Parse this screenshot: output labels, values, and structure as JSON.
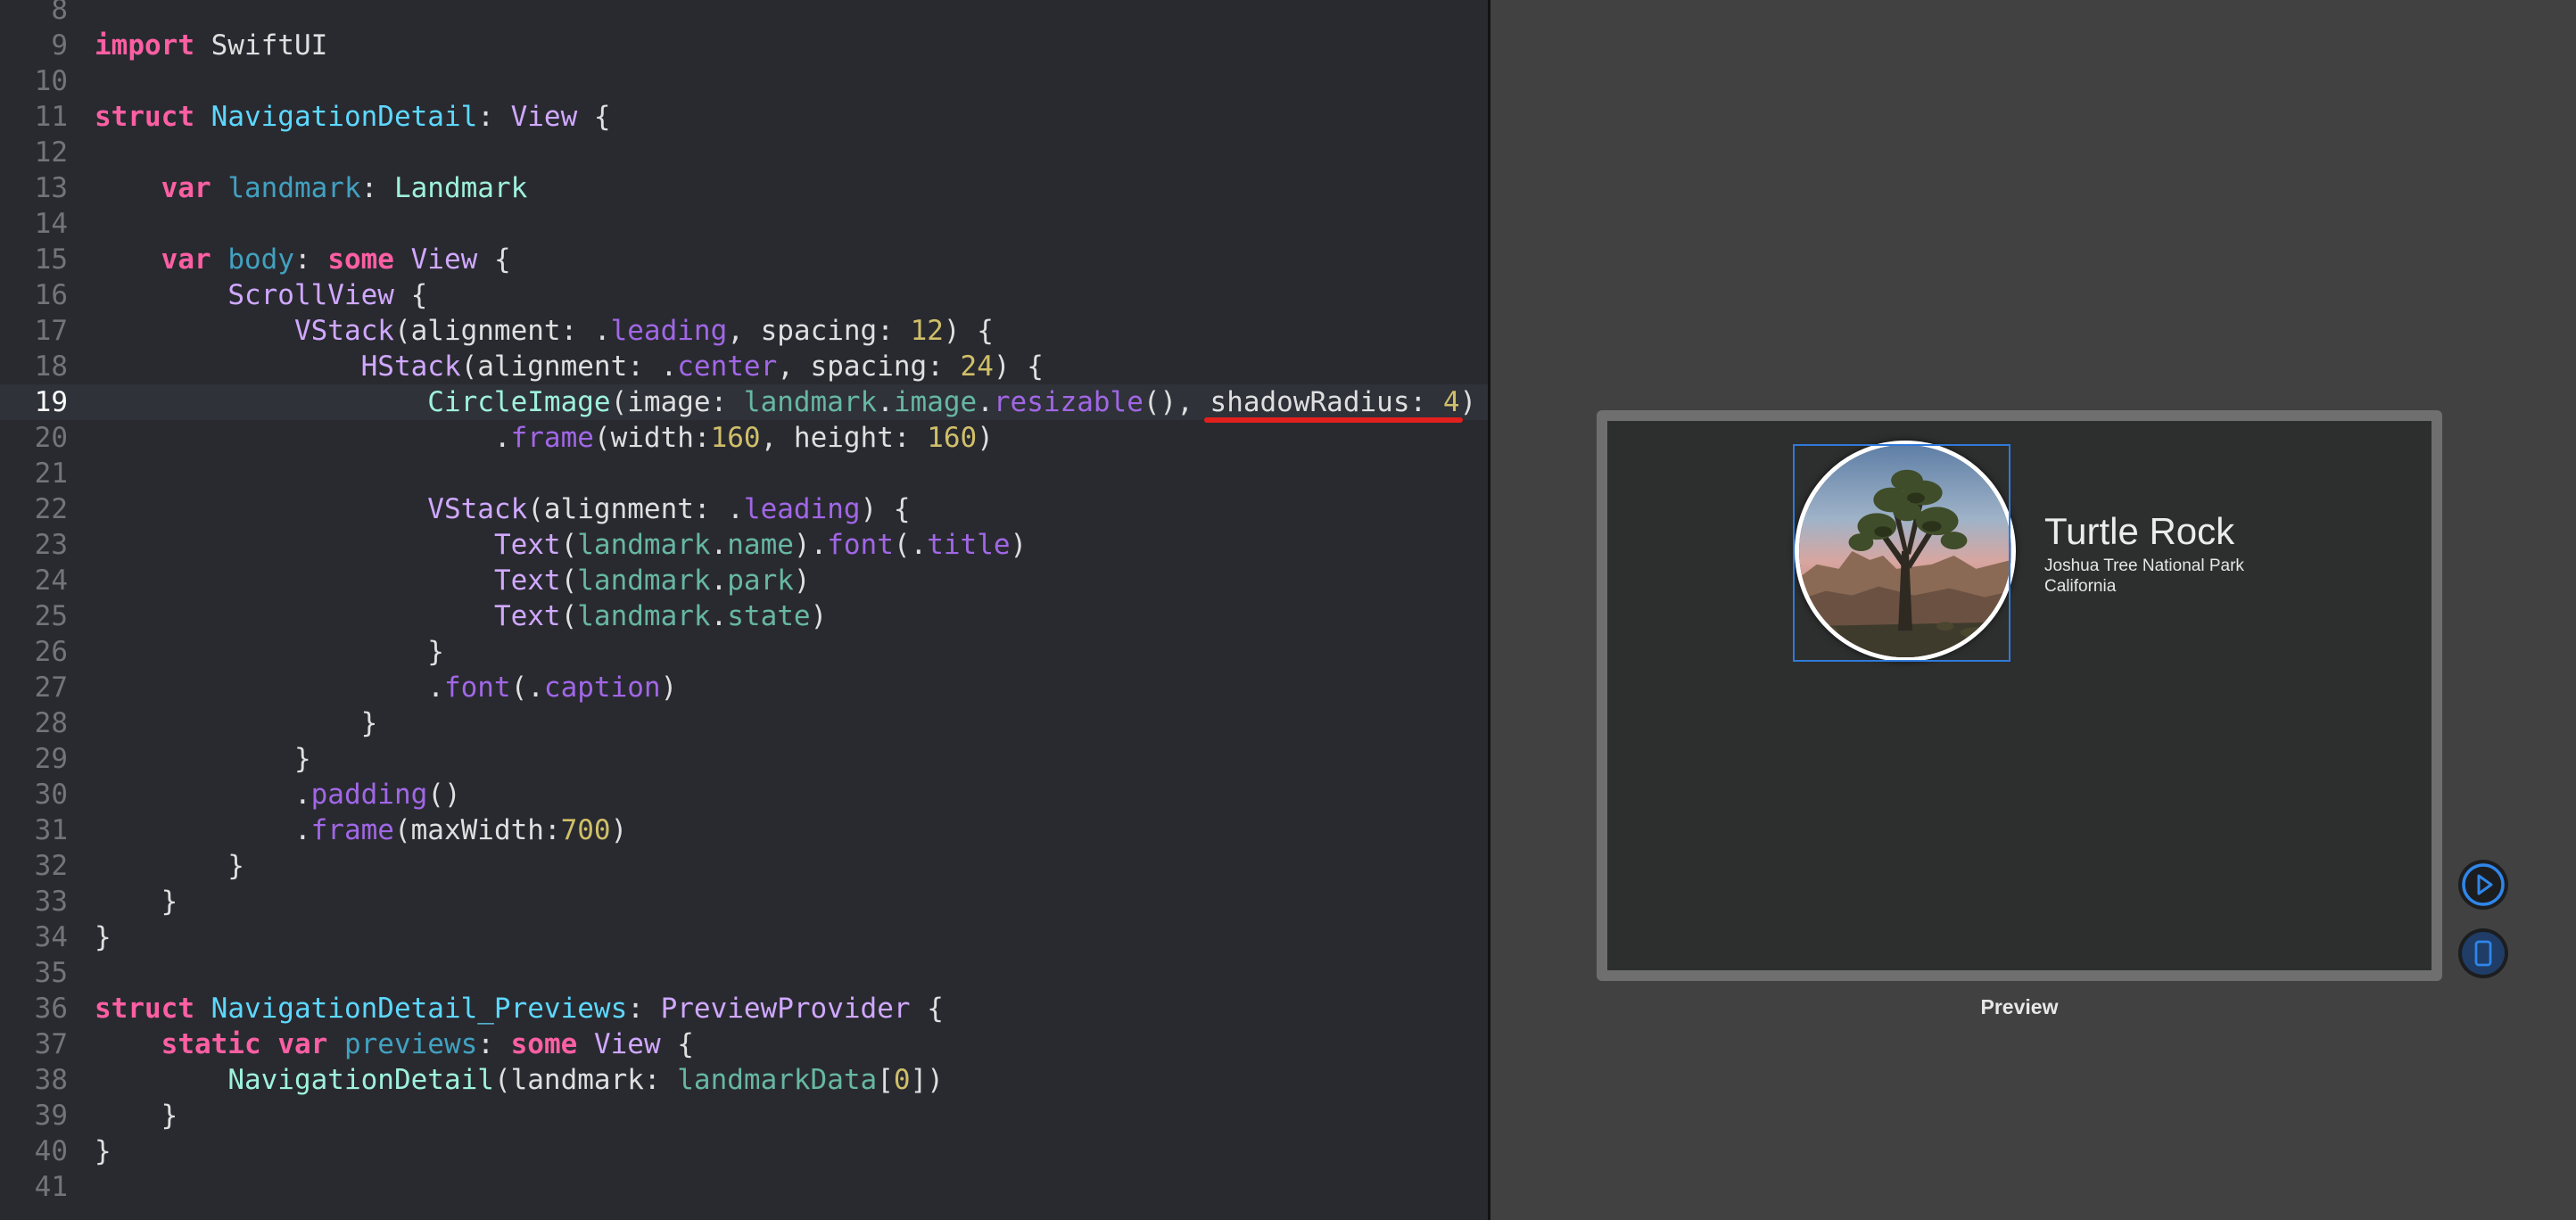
{
  "editor": {
    "current_line": "19",
    "lines": [
      {
        "n": "8",
        "t": []
      },
      {
        "n": "9",
        "t": [
          [
            "kw",
            "import"
          ],
          [
            "pl",
            " SwiftUI"
          ]
        ]
      },
      {
        "n": "10",
        "t": []
      },
      {
        "n": "11",
        "t": [
          [
            "kw",
            "struct"
          ],
          [
            "pl",
            " "
          ],
          [
            "typ",
            "NavigationDetail"
          ],
          [
            "pl",
            ": "
          ],
          [
            "ptype",
            "View"
          ],
          [
            "pl",
            " {"
          ]
        ]
      },
      {
        "n": "12",
        "t": []
      },
      {
        "n": "13",
        "t": [
          [
            "pl",
            "    "
          ],
          [
            "kw",
            "var"
          ],
          [
            "pl",
            " "
          ],
          [
            "decl",
            "landmark"
          ],
          [
            "pl",
            ": "
          ],
          [
            "tp",
            "Landmark"
          ]
        ]
      },
      {
        "n": "14",
        "t": []
      },
      {
        "n": "15",
        "t": [
          [
            "pl",
            "    "
          ],
          [
            "kw",
            "var"
          ],
          [
            "pl",
            " "
          ],
          [
            "decl",
            "body"
          ],
          [
            "pl",
            ": "
          ],
          [
            "kw",
            "some"
          ],
          [
            "pl",
            " "
          ],
          [
            "ptype",
            "View"
          ],
          [
            "pl",
            " {"
          ]
        ]
      },
      {
        "n": "16",
        "t": [
          [
            "pl",
            "        "
          ],
          [
            "ptype",
            "ScrollView"
          ],
          [
            "pl",
            " {"
          ]
        ]
      },
      {
        "n": "17",
        "t": [
          [
            "pl",
            "            "
          ],
          [
            "ptype",
            "VStack"
          ],
          [
            "pl",
            "(alignment: ."
          ],
          [
            "mem",
            "leading"
          ],
          [
            "pl",
            ", spacing: "
          ],
          [
            "num",
            "12"
          ],
          [
            "pl",
            ") {"
          ]
        ]
      },
      {
        "n": "18",
        "t": [
          [
            "pl",
            "                "
          ],
          [
            "ptype",
            "HStack"
          ],
          [
            "pl",
            "(alignment: ."
          ],
          [
            "mem",
            "center"
          ],
          [
            "pl",
            ", spacing: "
          ],
          [
            "num",
            "24"
          ],
          [
            "pl",
            ") {"
          ]
        ]
      },
      {
        "n": "19",
        "t": [
          [
            "pl",
            "                    "
          ],
          [
            "tp",
            "CircleImage"
          ],
          [
            "pl",
            "(image: "
          ],
          [
            "prj",
            "landmark"
          ],
          [
            "pl",
            "."
          ],
          [
            "prj",
            "image"
          ],
          [
            "pl",
            "."
          ],
          [
            "mem",
            "resizable"
          ],
          [
            "pl",
            "(), shadowRadius: "
          ],
          [
            "num",
            "4"
          ],
          [
            "pl",
            ")"
          ]
        ]
      },
      {
        "n": "20",
        "t": [
          [
            "pl",
            "                        ."
          ],
          [
            "mem",
            "frame"
          ],
          [
            "pl",
            "(width:"
          ],
          [
            "num",
            "160"
          ],
          [
            "pl",
            ", height: "
          ],
          [
            "num",
            "160"
          ],
          [
            "pl",
            ")"
          ]
        ]
      },
      {
        "n": "21",
        "t": []
      },
      {
        "n": "22",
        "t": [
          [
            "pl",
            "                    "
          ],
          [
            "ptype",
            "VStack"
          ],
          [
            "pl",
            "(alignment: ."
          ],
          [
            "mem",
            "leading"
          ],
          [
            "pl",
            ") {"
          ]
        ]
      },
      {
        "n": "23",
        "t": [
          [
            "pl",
            "                        "
          ],
          [
            "ptype",
            "Text"
          ],
          [
            "pl",
            "("
          ],
          [
            "prj",
            "landmark"
          ],
          [
            "pl",
            "."
          ],
          [
            "prj",
            "name"
          ],
          [
            "pl",
            ")."
          ],
          [
            "mem",
            "font"
          ],
          [
            "pl",
            "(."
          ],
          [
            "mem",
            "title"
          ],
          [
            "pl",
            ")"
          ]
        ]
      },
      {
        "n": "24",
        "t": [
          [
            "pl",
            "                        "
          ],
          [
            "ptype",
            "Text"
          ],
          [
            "pl",
            "("
          ],
          [
            "prj",
            "landmark"
          ],
          [
            "pl",
            "."
          ],
          [
            "prj",
            "park"
          ],
          [
            "pl",
            ")"
          ]
        ]
      },
      {
        "n": "25",
        "t": [
          [
            "pl",
            "                        "
          ],
          [
            "ptype",
            "Text"
          ],
          [
            "pl",
            "("
          ],
          [
            "prj",
            "landmark"
          ],
          [
            "pl",
            "."
          ],
          [
            "prj",
            "state"
          ],
          [
            "pl",
            ")"
          ]
        ]
      },
      {
        "n": "26",
        "t": [
          [
            "pl",
            "                    }"
          ]
        ]
      },
      {
        "n": "27",
        "t": [
          [
            "pl",
            "                    ."
          ],
          [
            "mem",
            "font"
          ],
          [
            "pl",
            "(."
          ],
          [
            "mem",
            "caption"
          ],
          [
            "pl",
            ")"
          ]
        ]
      },
      {
        "n": "28",
        "t": [
          [
            "pl",
            "                }"
          ]
        ]
      },
      {
        "n": "29",
        "t": [
          [
            "pl",
            "            }"
          ]
        ]
      },
      {
        "n": "30",
        "t": [
          [
            "pl",
            "            ."
          ],
          [
            "mem",
            "padding"
          ],
          [
            "pl",
            "()"
          ]
        ]
      },
      {
        "n": "31",
        "t": [
          [
            "pl",
            "            ."
          ],
          [
            "mem",
            "frame"
          ],
          [
            "pl",
            "(maxWidth:"
          ],
          [
            "num",
            "700"
          ],
          [
            "pl",
            ")"
          ]
        ]
      },
      {
        "n": "32",
        "t": [
          [
            "pl",
            "        }"
          ]
        ]
      },
      {
        "n": "33",
        "t": [
          [
            "pl",
            "    }"
          ]
        ]
      },
      {
        "n": "34",
        "t": [
          [
            "pl",
            "}"
          ]
        ]
      },
      {
        "n": "35",
        "t": []
      },
      {
        "n": "36",
        "t": [
          [
            "kw",
            "struct"
          ],
          [
            "pl",
            " "
          ],
          [
            "typ",
            "NavigationDetail_Previews"
          ],
          [
            "pl",
            ": "
          ],
          [
            "ptype",
            "PreviewProvider"
          ],
          [
            "pl",
            " {"
          ]
        ]
      },
      {
        "n": "37",
        "t": [
          [
            "pl",
            "    "
          ],
          [
            "kw",
            "static"
          ],
          [
            "pl",
            " "
          ],
          [
            "kw",
            "var"
          ],
          [
            "pl",
            " "
          ],
          [
            "decl",
            "previews"
          ],
          [
            "pl",
            ": "
          ],
          [
            "kw",
            "some"
          ],
          [
            "pl",
            " "
          ],
          [
            "ptype",
            "View"
          ],
          [
            "pl",
            " {"
          ]
        ]
      },
      {
        "n": "38",
        "t": [
          [
            "pl",
            "        "
          ],
          [
            "tp",
            "NavigationDetail"
          ],
          [
            "pl",
            "(landmark: "
          ],
          [
            "prj",
            "landmarkData"
          ],
          [
            "pl",
            "["
          ],
          [
            "num",
            "0"
          ],
          [
            "pl",
            "])"
          ]
        ]
      },
      {
        "n": "39",
        "t": [
          [
            "pl",
            "    }"
          ]
        ]
      },
      {
        "n": "40",
        "t": [
          [
            "pl",
            "}"
          ]
        ]
      },
      {
        "n": "41",
        "t": []
      }
    ]
  },
  "preview": {
    "landmark_name": "Turtle Rock",
    "landmark_park": "Joshua Tree National Park",
    "landmark_state": "California",
    "label": "Preview",
    "buttons": [
      {
        "icon": "live-preview-play-icon"
      },
      {
        "icon": "preview-on-device-icon"
      }
    ]
  },
  "colors": {
    "editor_background": "#292a30",
    "preview_background": "#414141",
    "keyword": "#fc5fa3",
    "type": "#5dd8ff",
    "number": "#d0bf69",
    "error_underline": "#e2201e",
    "selection_frame": "#2f7ad9"
  }
}
